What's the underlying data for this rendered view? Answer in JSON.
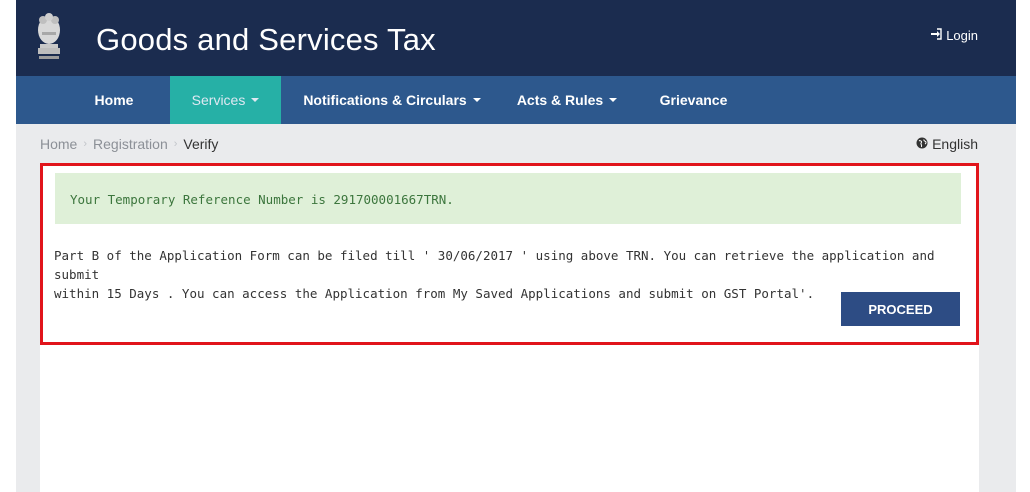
{
  "header": {
    "title": "Goods and Services Tax",
    "login_label": "Login",
    "login_icon": "sign-in-icon",
    "emblem_icon": "national-emblem-icon"
  },
  "nav": {
    "items": [
      {
        "label": "Home",
        "dropdown": false,
        "active": false
      },
      {
        "label": "Services",
        "dropdown": true,
        "active": true
      },
      {
        "label": "Notifications & Circulars",
        "dropdown": true,
        "active": false
      },
      {
        "label": "Acts & Rules",
        "dropdown": true,
        "active": false
      },
      {
        "label": "Grievance",
        "dropdown": false,
        "active": false
      }
    ]
  },
  "breadcrumb": {
    "items": [
      "Home",
      "Registration",
      "Verify"
    ],
    "separator": "›"
  },
  "language": {
    "label": "English",
    "icon": "globe-icon"
  },
  "alert": {
    "text": "Your Temporary Reference Number is 291700001667TRN."
  },
  "message": {
    "line1": "Part B of the Application Form can be filed till ' 30/06/2017 ' using above TRN. You can retrieve the application and submit",
    "line2": "within 15 Days . You can access the Application from My Saved Applications and submit on GST Portal'."
  },
  "actions": {
    "proceed_label": "PROCEED"
  },
  "colors": {
    "header_bg": "#1b2c4f",
    "nav_bg": "#2d588d",
    "nav_active_bg": "#26b0a6",
    "alert_bg": "#dff0d8",
    "alert_text": "#3c763d",
    "button_bg": "#2d4c84",
    "highlight_border": "#e1141b"
  }
}
